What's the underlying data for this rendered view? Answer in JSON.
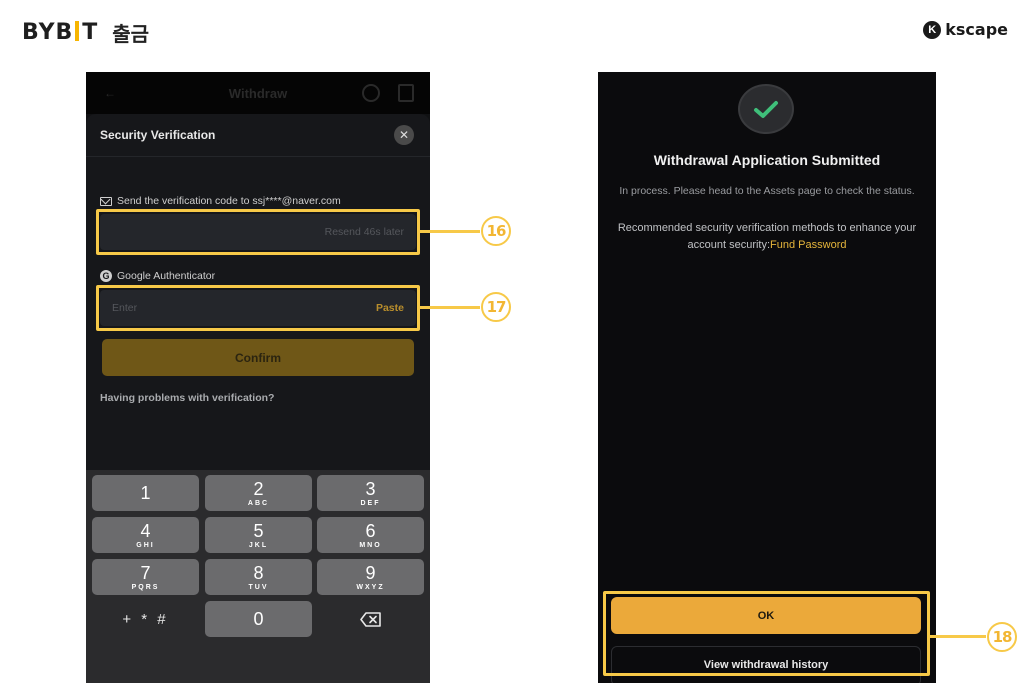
{
  "branding": {
    "logo": "BYBIT",
    "logo_left": "BYB",
    "logo_right": "T",
    "subtitle": "출금",
    "partner_logo": "kscape",
    "partner_mark": "K"
  },
  "colors": {
    "accent": "#f7c948",
    "brand_yellow": "#f7b500",
    "ok_button": "#eba93a",
    "confirm_disabled": "#6f5717",
    "success_check": "#3fbf7a"
  },
  "phone_left": {
    "background_header": {
      "title": "Withdraw",
      "back_icon": "back-arrow-icon",
      "help_icon": "help-circle-icon",
      "records_icon": "document-icon"
    },
    "sheet": {
      "title": "Security Verification",
      "close_icon": "close-icon",
      "close_glyph": "✕",
      "email": {
        "icon": "mail-icon",
        "label": "Send the verification code to ssj****@naver.com",
        "value": "",
        "resend_text": "Resend 46s later"
      },
      "google_auth": {
        "icon": "google-icon",
        "icon_glyph": "G",
        "label": "Google Authenticator",
        "placeholder": "Enter",
        "paste_label": "Paste"
      },
      "confirm_label": "Confirm",
      "problems_link": "Having problems with verification?"
    },
    "keypad": {
      "keys": [
        {
          "num": "1",
          "letters": ""
        },
        {
          "num": "2",
          "letters": "ABC"
        },
        {
          "num": "3",
          "letters": "DEF"
        },
        {
          "num": "4",
          "letters": "GHI"
        },
        {
          "num": "5",
          "letters": "JKL"
        },
        {
          "num": "6",
          "letters": "MNO"
        },
        {
          "num": "7",
          "letters": "PQRS"
        },
        {
          "num": "8",
          "letters": "TUV"
        },
        {
          "num": "9",
          "letters": "WXYZ"
        },
        {
          "num": "0",
          "letters": ""
        }
      ],
      "symbols_label": "+ * #",
      "backspace_icon": "backspace-icon"
    }
  },
  "phone_right": {
    "status_icon": "check-circle-icon",
    "title": "Withdrawal Application Submitted",
    "description": "In process. Please head to the Assets page to check the status.",
    "recommendation_text": "Recommended security verification methods to enhance your account security:",
    "recommendation_link": "Fund Password",
    "ok_label": "OK",
    "history_label": "View withdrawal history"
  },
  "annotations": [
    {
      "number": "16",
      "label": "⑯"
    },
    {
      "number": "17",
      "label": "⑰"
    },
    {
      "number": "18",
      "label": "⑱"
    }
  ]
}
